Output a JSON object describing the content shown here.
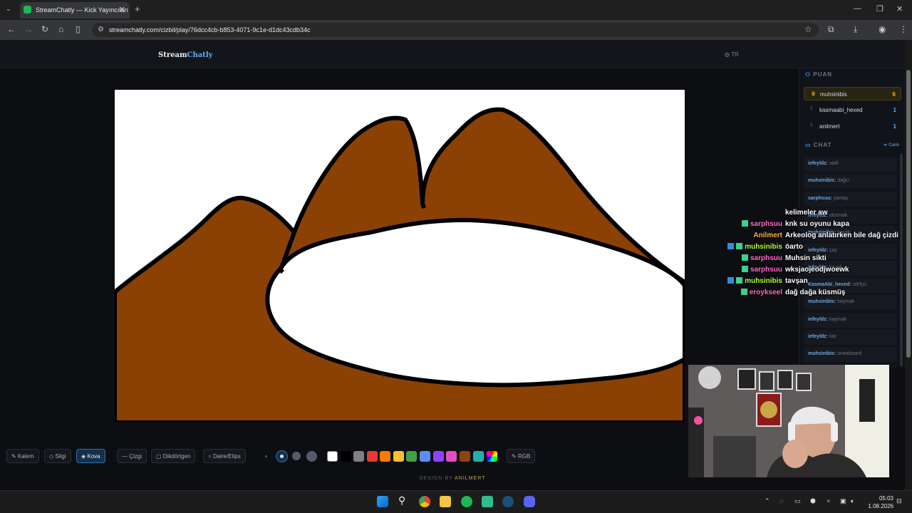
{
  "browser": {
    "tab_title": "StreamChatly — Kick Yayıncıları",
    "url": "streamchatly.com/cizbil/play/76dcc4cb-b853-4071-9c1e-d1dc43cdb34c"
  },
  "site": {
    "logo_part1": "Stream",
    "logo_part2": "Chatly",
    "language": "TR"
  },
  "scoreboard": {
    "heading": "PUAN",
    "rows": [
      {
        "rank": "",
        "name": "muhsinibis",
        "points": "6"
      },
      {
        "rank": "2",
        "name": "kasmaabi_hexed",
        "points": "1"
      },
      {
        "rank": "3",
        "name": "anilmert",
        "points": "1"
      }
    ]
  },
  "chat": {
    "heading": "CHAT",
    "live_label": "Canlı",
    "messages": [
      {
        "user": "iefeyldz:",
        "text": "vadi"
      },
      {
        "user": "muhsinibis:",
        "text": "dağcı"
      },
      {
        "user": "sarphsuu:",
        "text": "yamaç"
      },
      {
        "user": "iefeyldz:",
        "text": "oturmak"
      },
      {
        "user": "muhsinibis:",
        "text": "kayak"
      },
      {
        "user": "iefeyldz:",
        "text": "çay"
      },
      {
        "user": "iefeyldz:",
        "text": "kayak"
      },
      {
        "user": "KasmaAbi_hexed:",
        "text": "sörfçü"
      },
      {
        "user": "muhsinibis:",
        "text": "kaymak"
      },
      {
        "user": "iefeyldz:",
        "text": "kaymak"
      },
      {
        "user": "iefeyldz:",
        "text": "kar"
      },
      {
        "user": "muhsinibis:",
        "text": "snowboard"
      }
    ]
  },
  "overlay_chat": [
    {
      "name": "",
      "text": "kelimeler aw",
      "color": "#ffffff",
      "badges": 0
    },
    {
      "name": "sarphsuu",
      "text": "knk su oyunu kapa",
      "color": "#ff6ec7",
      "badges": 1
    },
    {
      "name": "Anilmert",
      "text": "Arkeolog anlatırken bile dağ çizdi",
      "color": "#ffb347",
      "badges": 0
    },
    {
      "name": "muhsinibis",
      "text": "öarto",
      "color": "#b6ff3b",
      "badges": 2
    },
    {
      "name": "sarphsuu",
      "text": "Muhsin sikti",
      "color": "#ff6ec7",
      "badges": 1
    },
    {
      "name": "sarphsuu",
      "text": "wksjaojeodjwoewk",
      "color": "#ff6ec7",
      "badges": 1
    },
    {
      "name": "muhsinibis",
      "text": "tavşan",
      "color": "#b6ff3b",
      "badges": 2
    },
    {
      "name": "eroykseel",
      "text": "dağ dağa küsmüş",
      "color": "#ff6ec7",
      "badges": 1
    }
  ],
  "tools": {
    "pen": "Kalem",
    "eraser": "Silgi",
    "bucket": "Kova",
    "line": "Çizgi",
    "rect": "Dikdörtgen",
    "ellipse": "Daire/Elips",
    "rgb": "RGB"
  },
  "palette": [
    "#ffffff",
    "#000000",
    "#808080",
    "#e53935",
    "#f57c00",
    "#fbc02d",
    "#43a047",
    "#5c8dff",
    "#8e44ff",
    "#e84cc4",
    "#8b4513",
    "#20b2aa"
  ],
  "brown_fill": "#8b4104",
  "credit": {
    "prefix": "DESIGN BY",
    "name": "ANİLMERT"
  },
  "taskbar": {
    "time": "05:03",
    "date": "1.08.2026"
  }
}
